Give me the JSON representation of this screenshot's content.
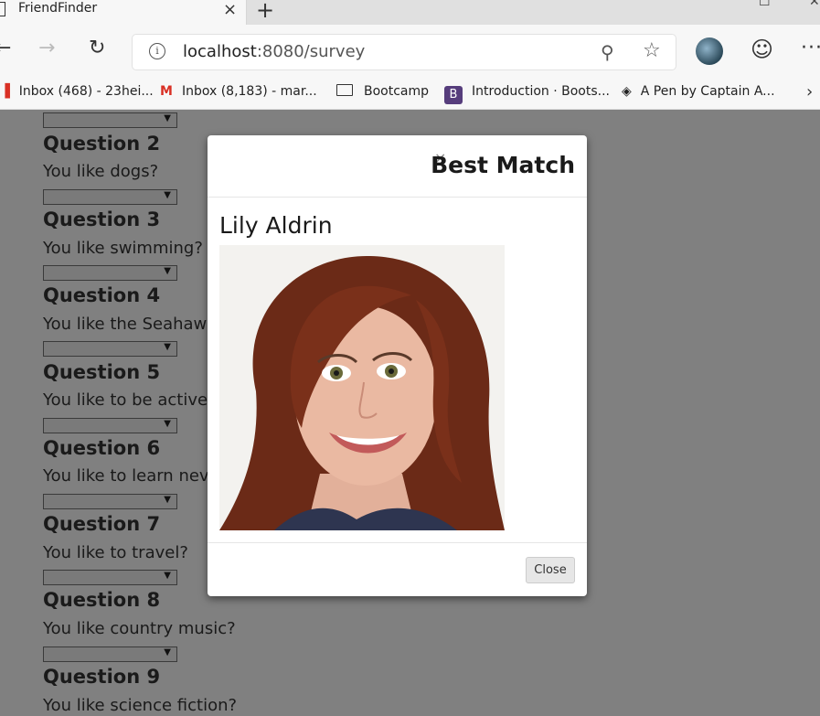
{
  "browser": {
    "tab_title": "FriendFinder",
    "tab_close": "×",
    "new_tab": "+",
    "url_host": "localhost",
    "url_rest": ":8080/survey",
    "bookmarks": [
      {
        "icon": "gmail-icon",
        "label": "Inbox (468) - 23hei..."
      },
      {
        "icon": "gmail-icon",
        "label": "Inbox (8,183) - mar..."
      },
      {
        "icon": "folder-icon",
        "label": "Bootcamp"
      },
      {
        "icon": "bootstrap-icon",
        "label": "Introduction · Boots..."
      },
      {
        "icon": "codepen-icon",
        "label": "A Pen by Captain A..."
      }
    ]
  },
  "survey": {
    "questions": [
      {
        "heading": "Question 2",
        "text": "You like dogs?"
      },
      {
        "heading": "Question 3",
        "text": "You like swimming?"
      },
      {
        "heading": "Question 4",
        "text": "You like the Seahaw"
      },
      {
        "heading": "Question 5",
        "text": "You like to be active"
      },
      {
        "heading": "Question 6",
        "text": "You like to learn nev"
      },
      {
        "heading": "Question 7",
        "text": "You like to travel?"
      },
      {
        "heading": "Question 8",
        "text": "You like country music?"
      },
      {
        "heading": "Question 9",
        "text": "You like science fiction?"
      }
    ]
  },
  "modal": {
    "close_x": "×",
    "title": "Best Match",
    "match_name": "Lily Aldrin",
    "close_button": "Close"
  }
}
